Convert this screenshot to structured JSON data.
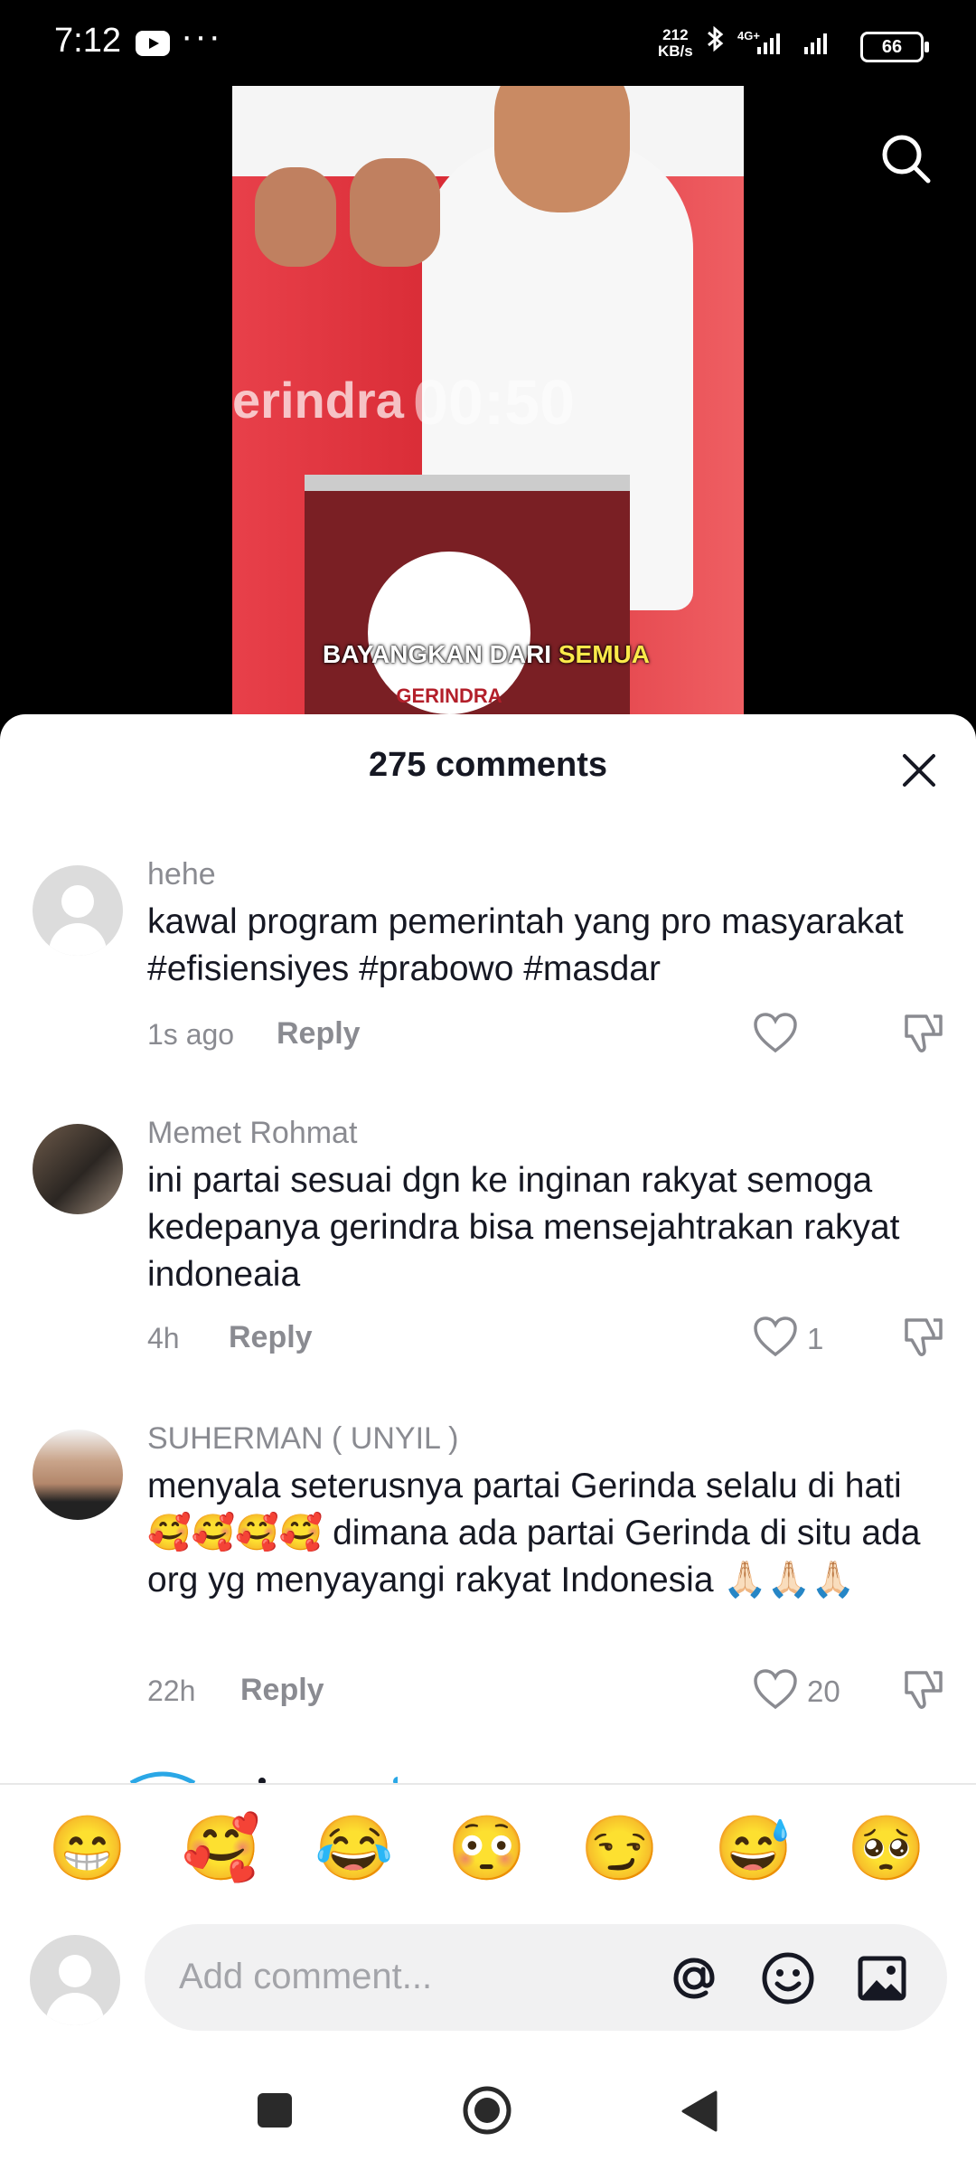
{
  "status_bar": {
    "time": "7:12",
    "dots": "···",
    "net_speed_value": "212",
    "net_speed_unit": "KB/s",
    "signal_label": "4G+",
    "battery": "66"
  },
  "video": {
    "timer": "00:50",
    "bg_text": "erindra",
    "caption_plain": "BAYANGKAN DARI ",
    "caption_highlight": "SEMUA",
    "podium_logo": "GERINDRA"
  },
  "sheet": {
    "title": "275 comments"
  },
  "comments": [
    {
      "username": "hehe",
      "text": "kawal program pemerintah yang pro masyarakat #efisiensiyes #prabowo #masdar",
      "time": "1s ago",
      "reply": "Reply",
      "likes": ""
    },
    {
      "username": "Memet Rohmat",
      "text": "ini partai sesuai dgn ke inginan rakyat semoga kedepanya gerindra bisa mensejahtrakan rakyat indoneaia",
      "time": "4h",
      "reply": "Reply",
      "likes": "1"
    },
    {
      "username": "SUHERMAN ( UNYIL )",
      "text": "menyala seterusnya partai Gerinda selalu di hati 🥰🥰🥰🥰 dimana ada partai Gerinda di situ ada org yg menyayangi rakyat Indonesia 🙏🏻🙏🏻🙏🏻",
      "time": "22h",
      "reply": "Reply",
      "likes": "20"
    }
  ],
  "emoji_bar": [
    "😁",
    "🥰",
    "😂",
    "😳",
    "😏",
    "😅",
    "🥺"
  ],
  "input": {
    "placeholder": "Add comment..."
  },
  "icons": {
    "search": "search-icon",
    "close": "close-icon",
    "heart": "heart-icon",
    "dislike": "dislike-icon",
    "mention": "at-icon",
    "emoji": "emoji-icon",
    "image": "image-icon"
  },
  "colors": {
    "text_primary": "#161823",
    "text_secondary": "#8a8b91",
    "input_bg": "#f1f1f2",
    "caption_highlight": "#fbe94a"
  }
}
